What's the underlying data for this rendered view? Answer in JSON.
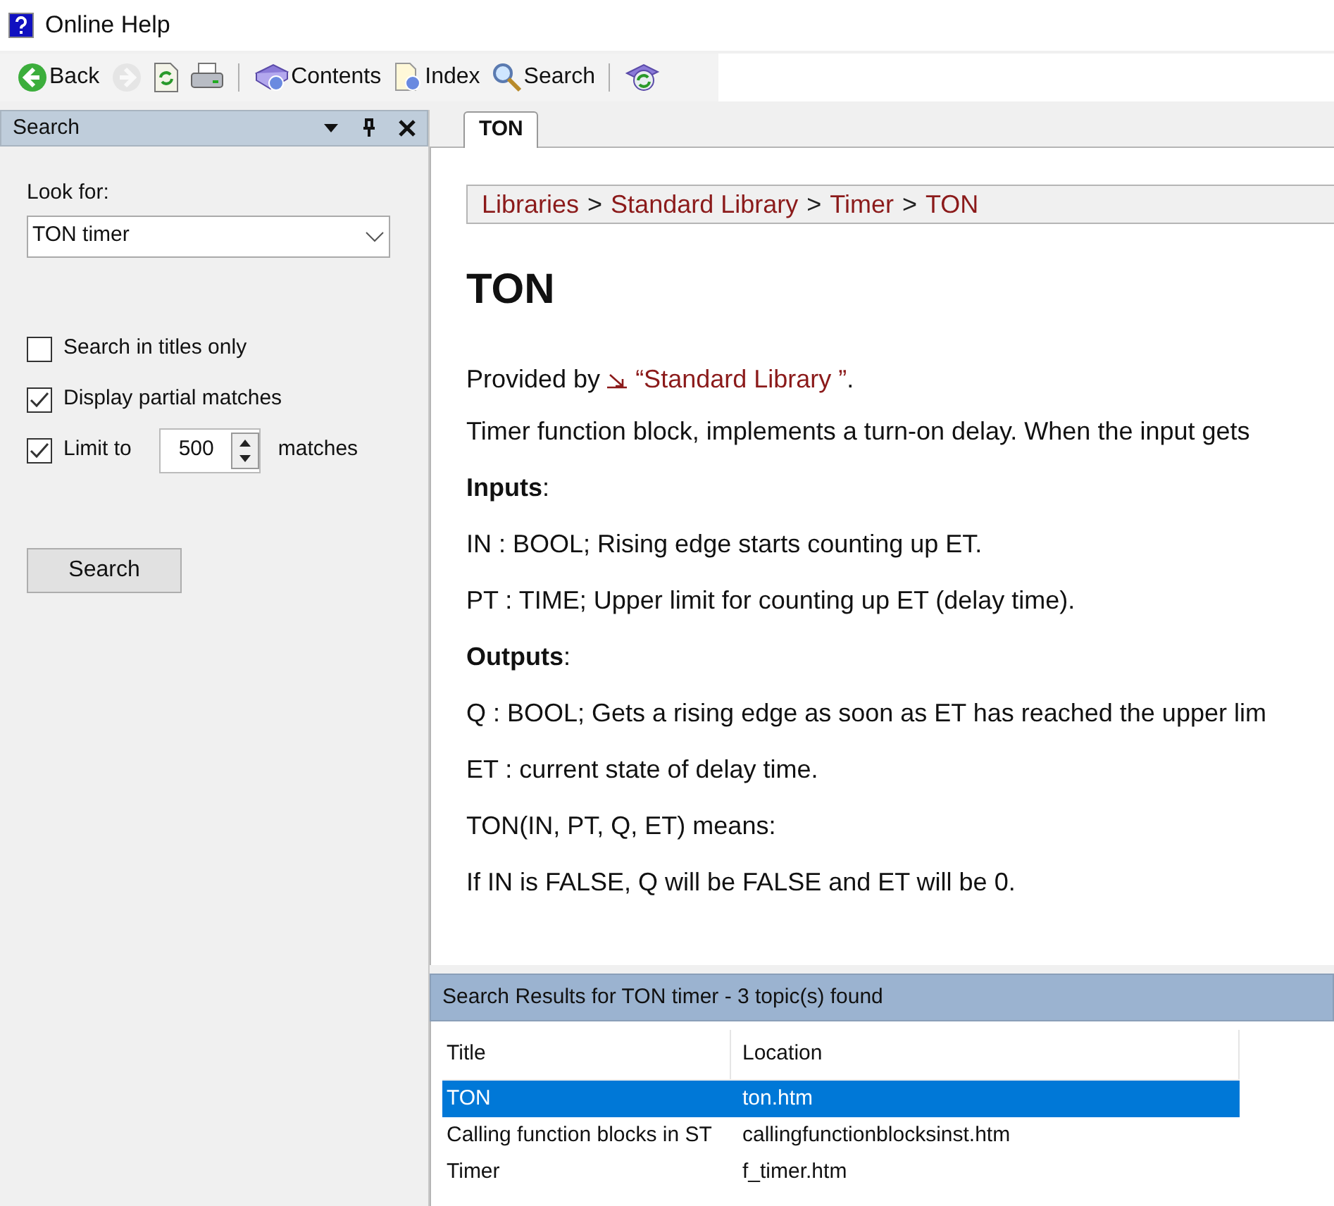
{
  "window": {
    "title": "Online Help"
  },
  "toolbar": [
    {
      "kind": "back",
      "label": "Back",
      "disabled": false
    },
    {
      "kind": "forward",
      "disabled": true
    },
    {
      "kind": "sync",
      "disabled": false
    },
    {
      "kind": "print",
      "disabled": false
    },
    {
      "kind": "sep"
    },
    {
      "kind": "contents",
      "label": "Contents",
      "disabled": false
    },
    {
      "kind": "index",
      "label": "Index",
      "disabled": false
    },
    {
      "kind": "search",
      "label": "Search",
      "disabled": false
    },
    {
      "kind": "sep"
    },
    {
      "kind": "refresh",
      "disabled": false
    }
  ],
  "search_panel": {
    "title": "Search",
    "look_for_label": "Look for:",
    "look_for_value": "TON timer",
    "options": [
      {
        "label": "Search in titles only",
        "checked": false
      },
      {
        "label": "Display partial matches",
        "checked": true
      },
      {
        "label": "Limit to",
        "checked": true,
        "limit": "500",
        "suffix": "matches"
      }
    ],
    "button": "Search"
  },
  "tabs": [
    {
      "label": "TON",
      "selected": true
    }
  ],
  "breadcrumb": [
    "Libraries",
    "Standard Library",
    "Timer",
    "TON"
  ],
  "breadcrumb_separator": ">",
  "content": [
    {
      "kind": "title",
      "text": "TON"
    },
    {
      "kind": "provided",
      "text": "Provided by",
      "link": "“Standard Library ”",
      "after": "."
    },
    {
      "kind": "para",
      "text": "Timer function block, implements a turn-on delay. When the input gets"
    },
    {
      "kind": "para",
      "text": "**Inputs**:"
    },
    {
      "kind": "para",
      "text": "IN : BOOL; Rising edge starts counting up ET."
    },
    {
      "kind": "para",
      "text": "PT : TIME; Upper limit for counting up ET (delay time)."
    },
    {
      "kind": "para",
      "text": "**Outputs**:"
    },
    {
      "kind": "para",
      "text": "Q : BOOL; Gets a rising edge as soon as ET has reached the upper lim"
    },
    {
      "kind": "para",
      "text": "ET : current state of delay time."
    },
    {
      "kind": "para",
      "text": "TON(IN, PT, Q, ET) means:"
    },
    {
      "kind": "para",
      "text": "If IN is FALSE, Q will be FALSE and ET will be 0."
    }
  ],
  "results": {
    "title": "Search Results for TON timer - 3 topic(s) found",
    "columns": [
      "Title",
      "Location"
    ],
    "rows": [
      {
        "title": "TON",
        "location": "ton.htm",
        "selected": true
      },
      {
        "title": "Calling function blocks in ST",
        "location": "callingfunctionblocksinst.htm",
        "selected": false
      },
      {
        "title": "Timer",
        "location": "f_timer.htm",
        "selected": false
      }
    ]
  }
}
